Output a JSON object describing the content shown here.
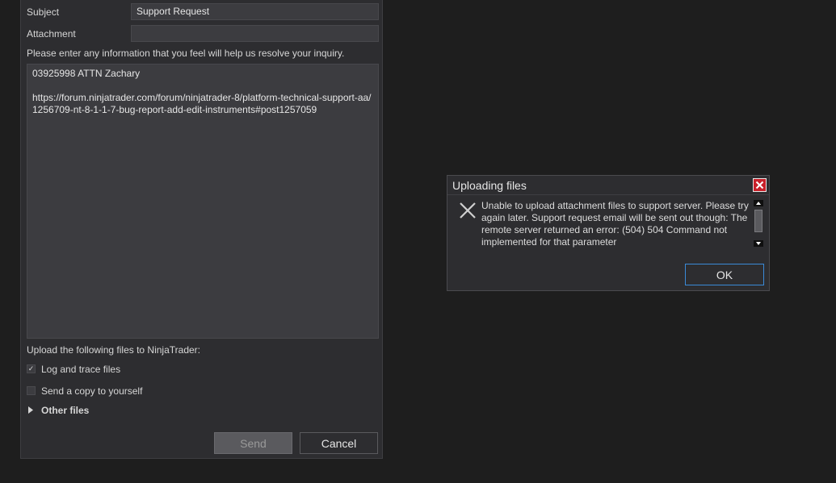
{
  "form": {
    "subject_label": "Subject",
    "subject_value": "Support Request",
    "attachment_label": "Attachment",
    "attachment_value": "",
    "instructions": "Please enter any information that you feel will help us resolve your inquiry.",
    "message": "03925998 ATTN Zachary\n\nhttps://forum.ninjatrader.com/forum/ninjatrader-8/platform-technical-support-aa/1256709-nt-8-1-1-7-bug-report-add-edit-instruments#post1257059",
    "upload_label": "Upload the following files to NinjaTrader:",
    "log_files_label": "Log and trace files",
    "log_files_checked": true,
    "copy_label": "Send a copy to yourself",
    "copy_checked": false,
    "other_files_label": "Other files",
    "send_label": "Send",
    "cancel_label": "Cancel"
  },
  "dialog": {
    "title": "Uploading files",
    "message": "Unable to upload attachment files to support server. Please try again later. Support request email will be sent out though: The remote server returned an error: (504) 504 Command not implemented for that parameter",
    "ok_label": "OK",
    "close_icon": "close-icon",
    "error_icon": "error-x-icon"
  },
  "colors": {
    "background": "#1e1e1e",
    "panel": "#2d2d30",
    "input": "#3c3c40",
    "close_red": "#c8202a",
    "focus_blue": "#3a8ad8"
  }
}
